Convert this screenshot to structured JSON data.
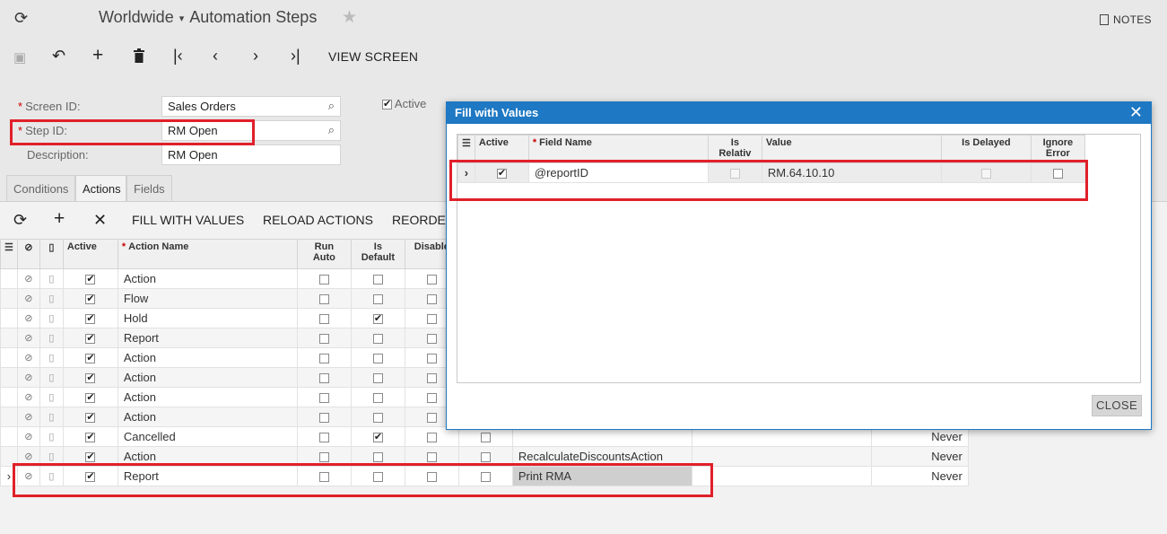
{
  "header": {
    "breadcrumb_root": "Worldwide",
    "title": "Automation Steps",
    "notes_label": "NOTES"
  },
  "toolbar": {
    "view_screen_label": "VIEW SCREEN"
  },
  "form": {
    "screen_id_label": "Screen ID:",
    "screen_id_value": "Sales Orders",
    "step_id_label": "Step ID:",
    "step_id_value": "RM Open",
    "description_label": "Description:",
    "description_value": "RM Open",
    "active_label": "Active",
    "active_checked": true
  },
  "tabs": [
    "Conditions",
    "Actions",
    "Fields"
  ],
  "grid_toolbar": {
    "fill_label": "FILL WITH VALUES",
    "reload_label": "RELOAD ACTIONS",
    "reorder_label": "REORDE"
  },
  "grid": {
    "columns": {
      "active": "Active",
      "action_name": "Action Name",
      "run_auto_1": "Run",
      "run_auto_2": "Auto",
      "is_default_1": "Is",
      "is_default_2": "Default",
      "disable": "Disable"
    },
    "rows": [
      {
        "active": true,
        "name": "Action",
        "run_auto": false,
        "is_default": false,
        "disable": false,
        "extra": false,
        "menu": "",
        "time": ""
      },
      {
        "active": true,
        "name": "Flow",
        "run_auto": false,
        "is_default": false,
        "disable": false,
        "extra": false,
        "menu": "",
        "time": ""
      },
      {
        "active": true,
        "name": "Hold",
        "run_auto": false,
        "is_default": true,
        "disable": false,
        "extra": false,
        "menu": "",
        "time": ""
      },
      {
        "active": true,
        "name": "Report",
        "run_auto": false,
        "is_default": false,
        "disable": false,
        "extra": false,
        "menu": "",
        "time": ""
      },
      {
        "active": true,
        "name": "Action",
        "run_auto": false,
        "is_default": false,
        "disable": false,
        "extra": false,
        "menu": "",
        "time": ""
      },
      {
        "active": true,
        "name": "Action",
        "run_auto": false,
        "is_default": false,
        "disable": false,
        "extra": false,
        "menu": "",
        "time": ""
      },
      {
        "active": true,
        "name": "Action",
        "run_auto": false,
        "is_default": false,
        "disable": false,
        "extra": false,
        "menu": "",
        "time": ""
      },
      {
        "active": true,
        "name": "Action",
        "run_auto": false,
        "is_default": false,
        "disable": false,
        "extra": false,
        "menu": "",
        "time": ""
      },
      {
        "active": true,
        "name": "Cancelled",
        "run_auto": false,
        "is_default": true,
        "disable": false,
        "extra": false,
        "menu": "",
        "time": "Never"
      },
      {
        "active": true,
        "name": "Action",
        "run_auto": false,
        "is_default": false,
        "disable": false,
        "extra": false,
        "menu": "RecalculateDiscountsAction",
        "time": "Never"
      },
      {
        "active": true,
        "name": "Report",
        "run_auto": false,
        "is_default": false,
        "disable": false,
        "extra": false,
        "menu": "Print RMA",
        "time": "Never"
      }
    ]
  },
  "dialog": {
    "title": "Fill with Values",
    "columns": {
      "active": "Active",
      "field_name": "Field Name",
      "is_relative_1": "Is",
      "is_relative_2": "Relativ",
      "value": "Value",
      "is_delayed": "Is Delayed",
      "ignore_error_1": "Ignore",
      "ignore_error_2": "Error"
    },
    "rows": [
      {
        "active": true,
        "field_name": "@reportID",
        "is_relative": false,
        "value": "RM.64.10.10",
        "is_delayed": false,
        "ignore_error": false
      }
    ],
    "close_label": "CLOSE"
  }
}
